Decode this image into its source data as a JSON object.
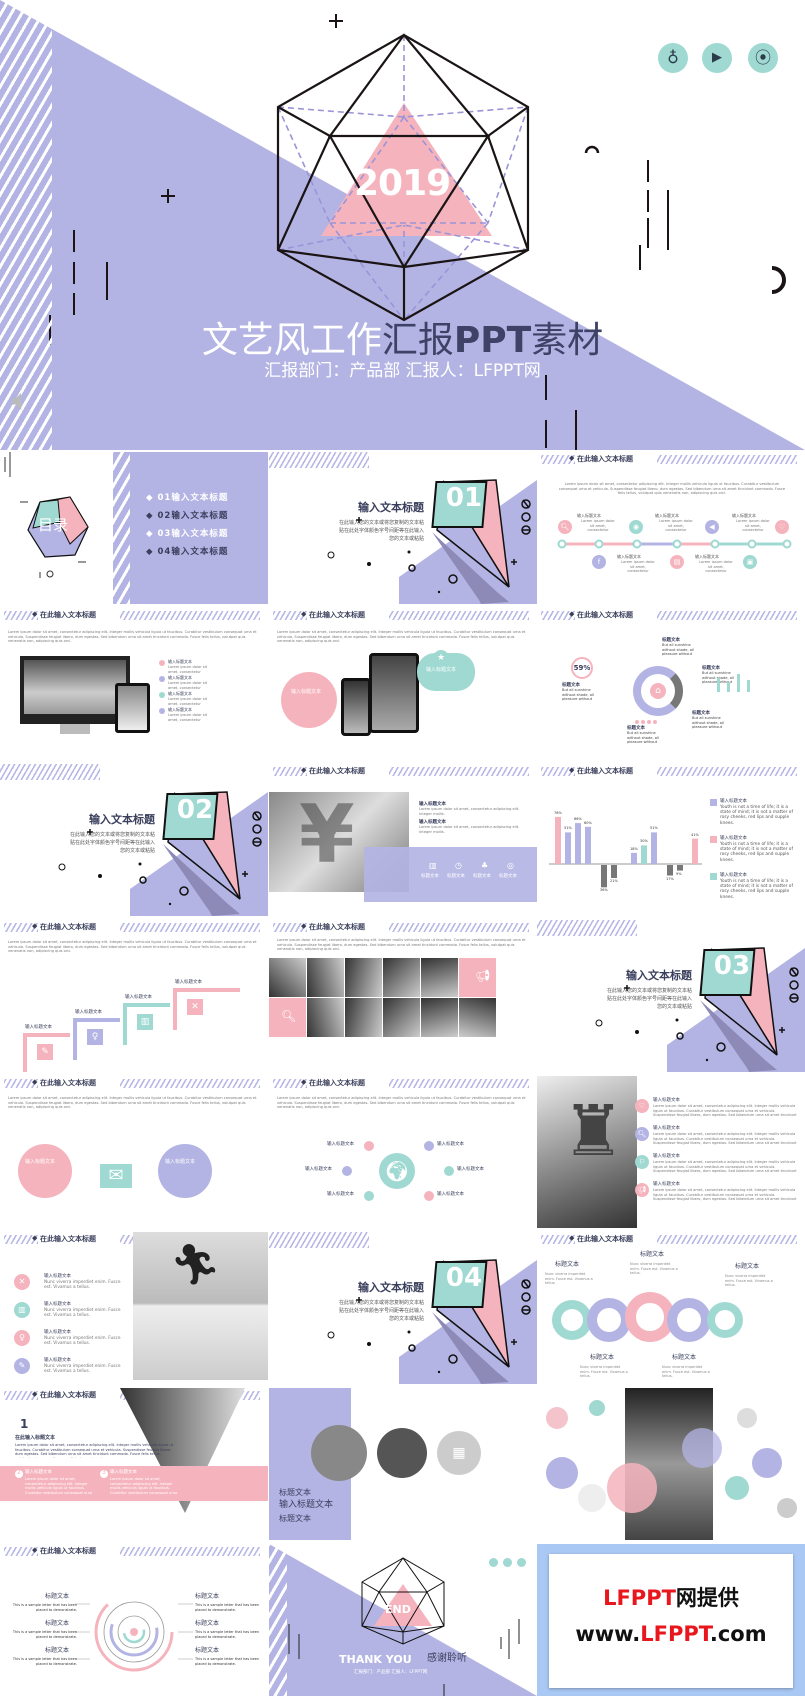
{
  "colors": {
    "lavender": "#b4b4e4",
    "pink": "#f5b4bd",
    "teal": "#9fd9d2",
    "dark": "#3a3f5c",
    "red": "#e8161d"
  },
  "hero": {
    "year": "2019",
    "title_light": "文艺风工作",
    "title_dark": "汇报",
    "title_bold": "PPT",
    "title_end": "素材",
    "subtitle": "汇报部门：产品部   汇报人：LFPPT网",
    "icons": [
      "lightbulb-icon",
      "play-icon",
      "location-pin-icon"
    ],
    "speaker_icon": "speaker-icon"
  },
  "common": {
    "header_title": "在此输入文本标题",
    "lorem": "Lorem ipsum dolor sit amet, consectetur adipiscing elit. Integer mollis vehicula ligula ut faucibus. Curabitur vestibulum consequat urna et vehicula. Suspendisse feugiat libero, dum egestas. Sed bibendum urna sit amet tincidunt commodo. Fusce felis tellus, volutpat quis venenatis non, adipiscing quis orci.",
    "lorem_short": "Lorem ipsum dolor sit amet, consectetur adipiscing elit. Integer mollis.",
    "section_title": "输入文本标题",
    "section_body": "在此输入您的文本或将您复制的文本粘贴在此处字体颜色字号间距等在此输入您的文本或粘贴",
    "item_title": "输入标题文本",
    "label": "标题文本",
    "youth": "Youth is not a time of life; it is a state of mind; it is not a matter of rosy cheeks, red lips and supple knees.",
    "nunc": "Nunc viverra imperdiet enim. Fusce est. Vivamus a tellus.",
    "sample": "This is a sample letter that has been placed to demonstrate."
  },
  "toc": {
    "title": "目录",
    "items": [
      "01输入文本标题",
      "02输入文本标题",
      "03输入文本标题",
      "04输入文本标题"
    ]
  },
  "sections": [
    "01",
    "02",
    "03",
    "04"
  ],
  "donut": {
    "percent": "59%",
    "caption": "But all sunshine without shade, all pleasure without"
  },
  "bars": {
    "labels": [
      "76%",
      "51%",
      "66%",
      "60%",
      "36%",
      "21%",
      "18%",
      "30%",
      "51%",
      "17%",
      "9%",
      "41%"
    ],
    "values": [
      76,
      51,
      66,
      60,
      -36,
      -21,
      18,
      30,
      51,
      -17,
      -9,
      41
    ]
  },
  "ring_labels": [
    "标题文本",
    "标题文本",
    "标题文本",
    "标题文本",
    "标题文本",
    "标题文本"
  ],
  "lavender_slide": {
    "line1": "标题文本",
    "line2": "输入标题文本",
    "line3": "标题文本"
  },
  "triangle_slide": {
    "num": "1",
    "heading": "在此输入标题文本",
    "n2": "2",
    "n3": "3"
  },
  "end": {
    "word": "END",
    "thanks": "THANK YOU",
    "thanks_cn": "感谢聆听",
    "sub": "汇报部门：产品部   汇报人：LFPPT网"
  },
  "credit": {
    "line1_red": "LFPPT",
    "line1_black": "网提供",
    "line2_a": "www.",
    "line2_red": "LFPPT",
    ".com": ".com",
    "line2_c": ".com"
  }
}
